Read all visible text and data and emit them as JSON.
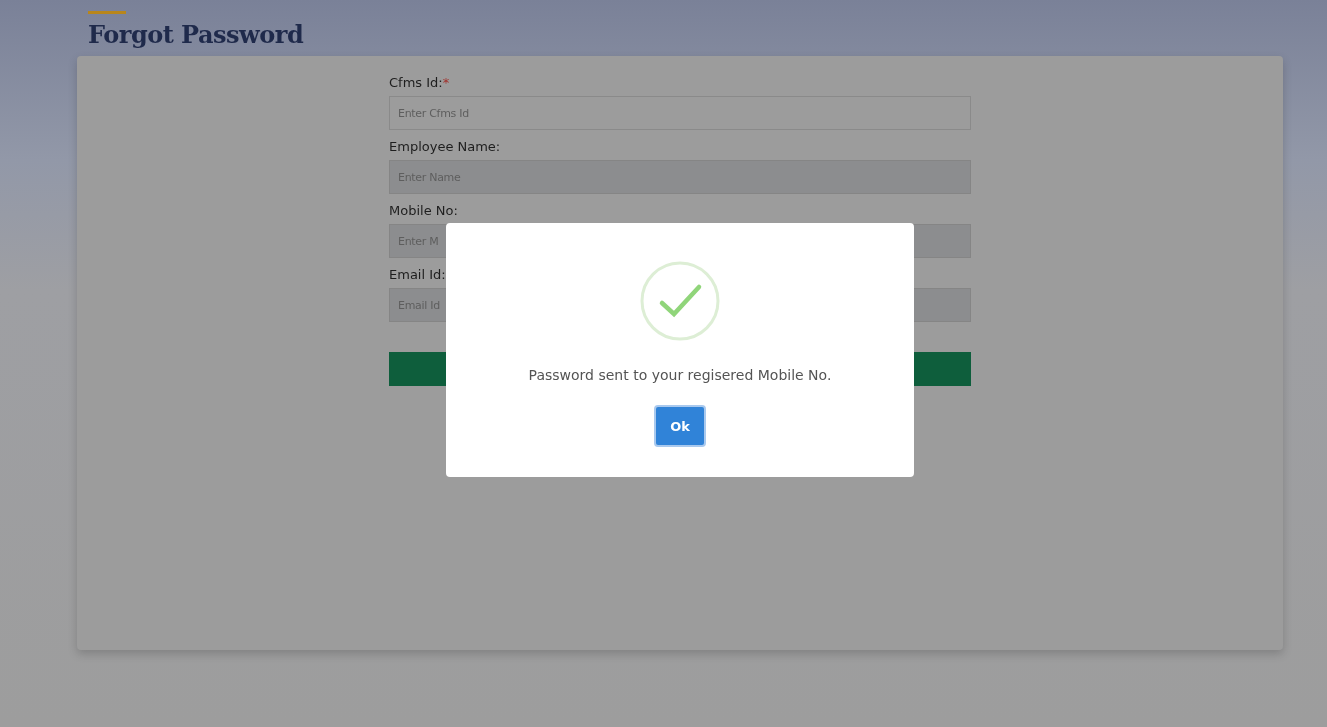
{
  "page": {
    "title": "Forgot Password"
  },
  "fields": [
    {
      "label": "Cfms Id:",
      "required_mark": "*",
      "placeholder": "Enter Cfms Id",
      "disabled": false
    },
    {
      "label": "Employee Name:",
      "placeholder": "Enter Name",
      "disabled": true
    },
    {
      "label": "Mobile No:",
      "placeholder": "Enter M",
      "disabled": true
    },
    {
      "label": "Email Id:",
      "placeholder": "Email Id",
      "disabled": true
    }
  ],
  "dialog": {
    "kind": "success",
    "message": "Password sent to your regisered Mobile No.",
    "button": "Ok"
  }
}
